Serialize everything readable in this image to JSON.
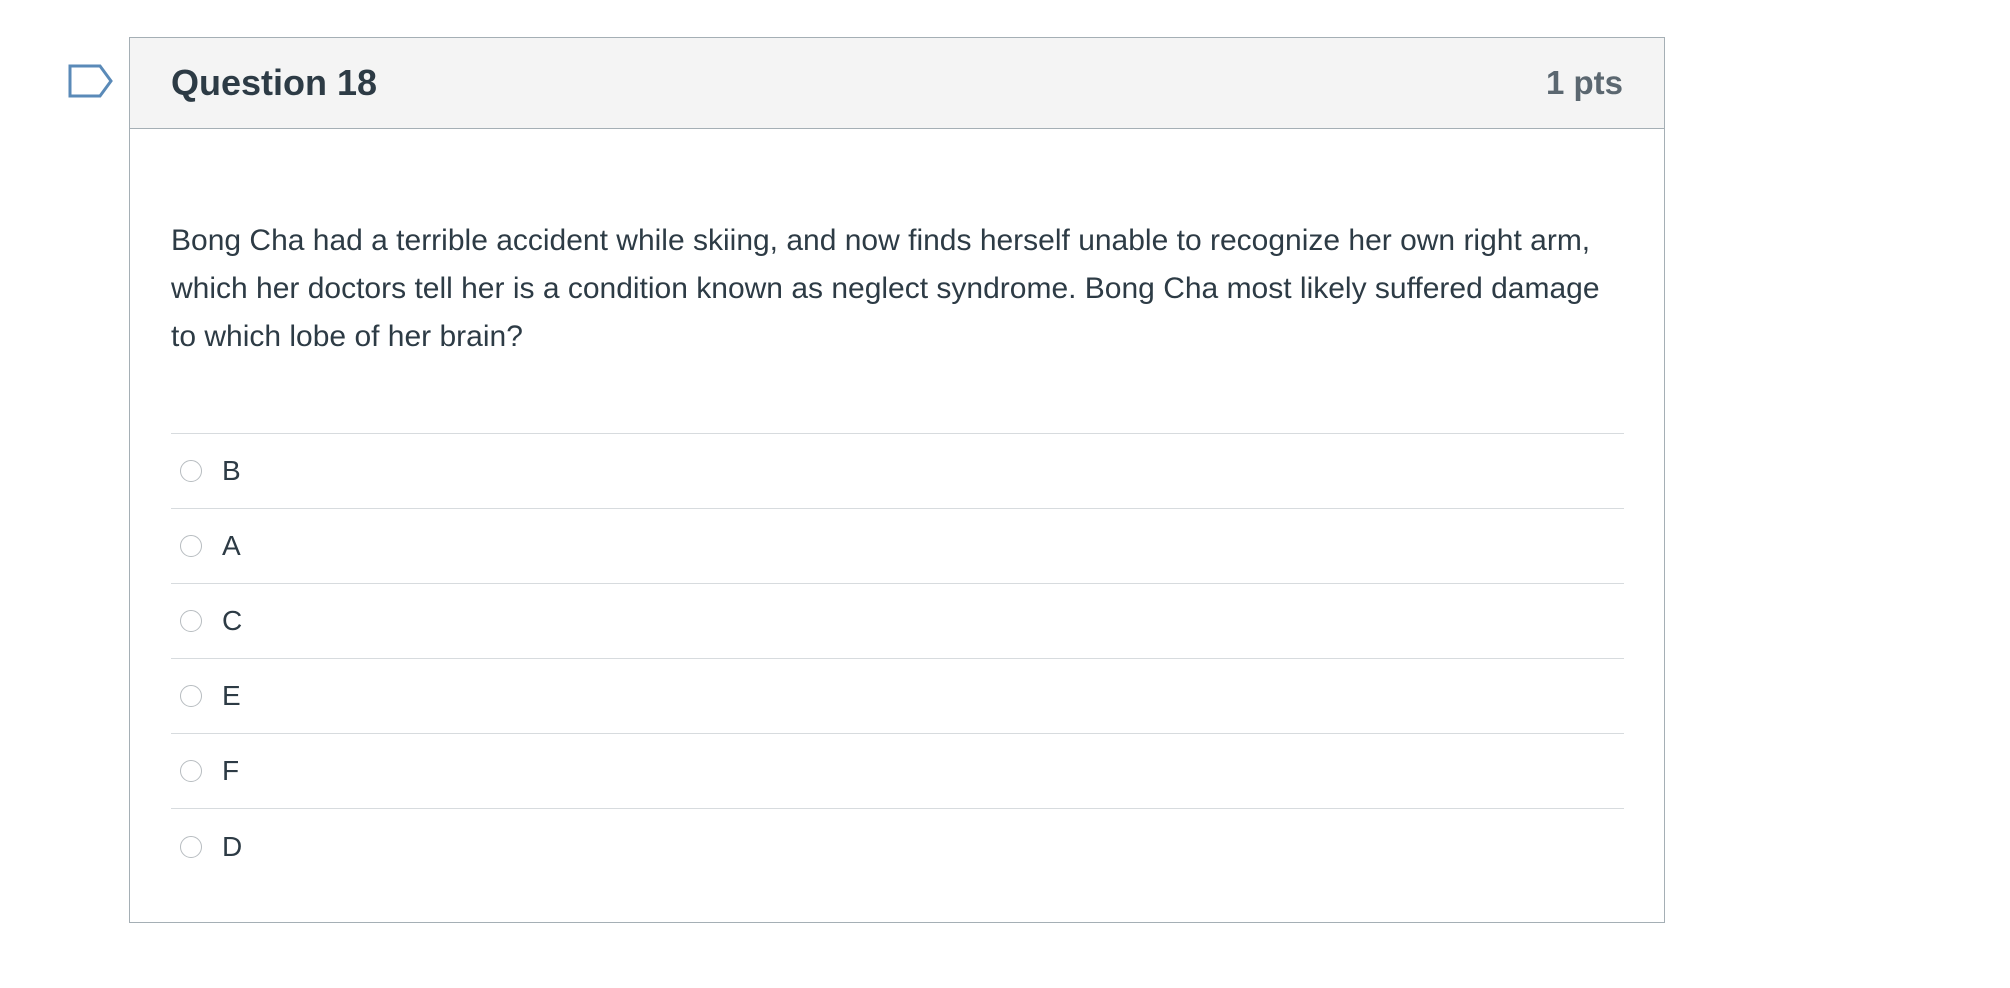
{
  "question": {
    "title": "Question 18",
    "points": "1 pts",
    "text": "Bong Cha had a terrible accident while skiing, and now finds herself unable to recognize her own right arm, which her doctors tell her is a condition known as neglect syndrome. Bong Cha most likely suffered damage to which lobe of her brain?",
    "answers": [
      {
        "label": "B"
      },
      {
        "label": "A"
      },
      {
        "label": "C"
      },
      {
        "label": "E"
      },
      {
        "label": "F"
      },
      {
        "label": "D"
      }
    ]
  },
  "icons": {
    "flag": "flag-outline-icon"
  },
  "colors": {
    "flag": "#5a8ab8",
    "header_bg": "#f4f4f4",
    "border": "#a5afb5",
    "text": "#2d3b45"
  }
}
